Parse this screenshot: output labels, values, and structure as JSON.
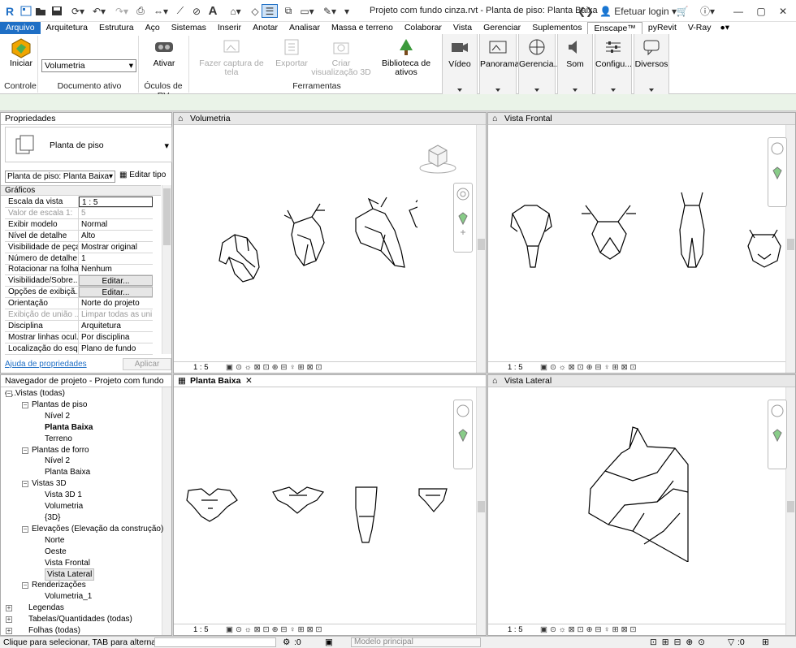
{
  "app": {
    "title": "Projeto com fundo cinza.rvt - Planta de piso: Planta Baixa",
    "logo": "R"
  },
  "titlebar": {
    "login": "Efetuar login"
  },
  "tabs": [
    "Arquivo",
    "Arquitetura",
    "Estrutura",
    "Aço",
    "Sistemas",
    "Inserir",
    "Anotar",
    "Analisar",
    "Massa e terreno",
    "Colaborar",
    "Vista",
    "Gerenciar",
    "Suplementos",
    "Enscape™",
    "pyRevit",
    "V-Ray"
  ],
  "active_tab": "Enscape™",
  "ribbon": {
    "iniciar": "Iniciar",
    "documento_value": "Volumetria",
    "ativar": "Ativar",
    "captura": "Fazer captura de tela",
    "exportar": "Exportar",
    "criar": "Criar visualização 3D",
    "biblioteca": "Biblioteca de ativos",
    "groups": {
      "controle": "Controle",
      "documento": "Documento ativo",
      "oculos": "Óculos de RV",
      "ferramentas": "Ferramentas"
    },
    "enscape": [
      "Vídeo",
      "Panorama",
      "Gerencia...",
      "Som",
      "Configu...",
      "Diversos"
    ]
  },
  "properties": {
    "title": "Propriedades",
    "type_name": "Planta de piso",
    "instance_select": "Planta de piso: Planta Baixa",
    "edit_type": "Editar tipo",
    "section": "Gráficos",
    "rows": [
      {
        "label": "Escala da vista",
        "value": "1 : 5"
      },
      {
        "label": "Valor de escala   1:",
        "value": "5"
      },
      {
        "label": "Exibir modelo",
        "value": "Normal"
      },
      {
        "label": "Nível de detalhe",
        "value": "Alto"
      },
      {
        "label": "Visibilidade de peças",
        "value": "Mostrar original"
      },
      {
        "label": "Número de detalhe",
        "value": "1"
      },
      {
        "label": "Rotacionar na folha",
        "value": "Nenhum"
      },
      {
        "label": "Visibilidade/Sobre...",
        "value": "Editar..."
      },
      {
        "label": "Opções de exibiçã...",
        "value": "Editar..."
      },
      {
        "label": "Orientação",
        "value": "Norte do projeto"
      },
      {
        "label": "Exibição de união ...",
        "value": "Limpar todas as uni..."
      },
      {
        "label": "Disciplina",
        "value": "Arquitetura"
      },
      {
        "label": "Mostrar linhas ocul...",
        "value": "Por disciplina"
      },
      {
        "label": "Localização do esq...",
        "value": "Plano de fundo"
      }
    ],
    "help": "Ajuda de propriedades",
    "apply": "Aplicar"
  },
  "browser": {
    "title": "Navegador de projeto - Projeto com fundo c...",
    "nodes": [
      "Vistas (todas)",
      "Plantas de piso",
      "Nível 2",
      "Planta Baixa",
      "Terreno",
      "Plantas de forro",
      "Nível 2",
      "Planta Baixa",
      "Vistas 3D",
      "Vista 3D 1",
      "Volumetria",
      "{3D}",
      "Elevações (Elevação da construção)",
      "Norte",
      "Oeste",
      "Vista Frontal",
      "Vista Lateral",
      "Renderizações",
      "Volumetria_1",
      "Legendas",
      "Tabelas/Quantidades (todas)",
      "Folhas (todas)"
    ]
  },
  "views": {
    "v1": "Volumetria",
    "v2": "Vista Frontal",
    "v3": "Planta Baixa",
    "v4": "Vista Lateral",
    "scale": "1 : 5"
  },
  "status": {
    "hint": "Clique para selecionar, TAB para alternat",
    "count": ":0",
    "model": "Modelo principal",
    "count2": ":0"
  }
}
